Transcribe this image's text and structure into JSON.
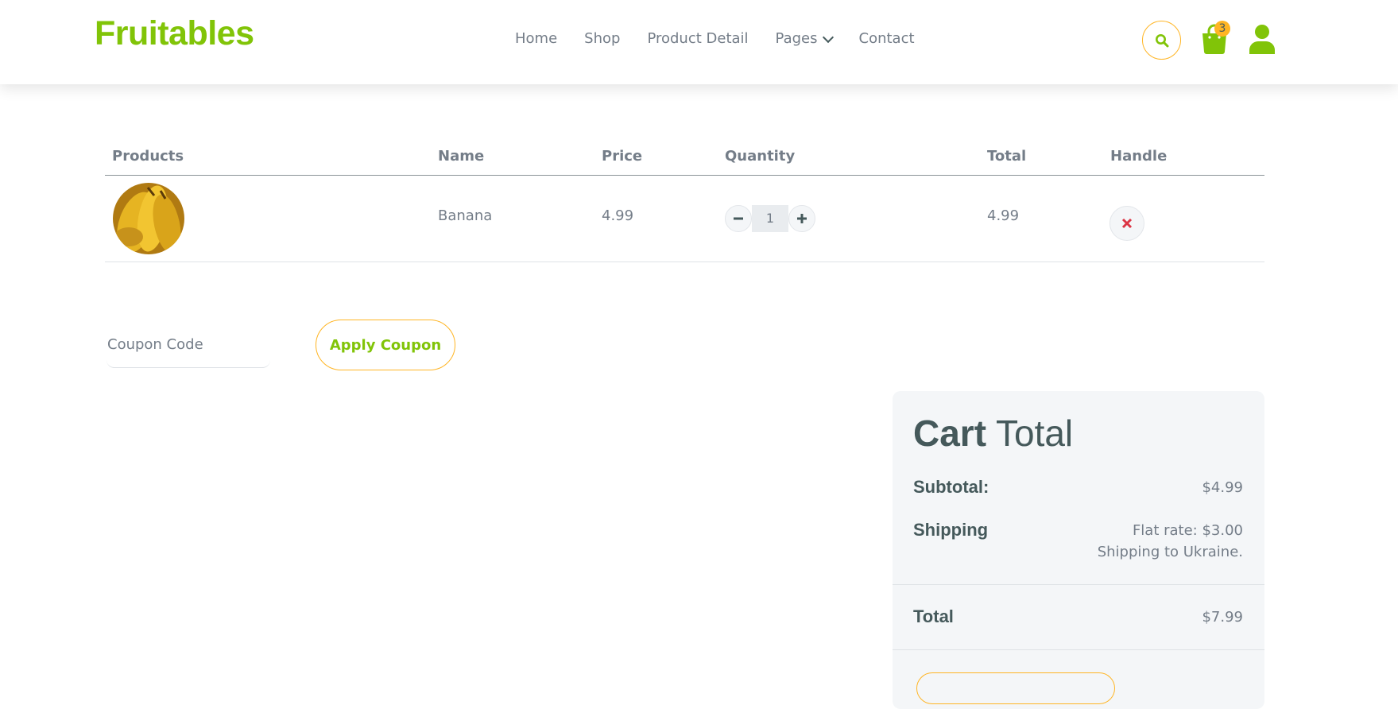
{
  "brand": {
    "name": "Fruitables",
    "color": "#81c408",
    "accent": "#ffb524"
  },
  "nav": {
    "items": [
      "Home",
      "Shop",
      "Product Detail",
      "Pages",
      "Contact"
    ],
    "pages_has_dropdown": true
  },
  "header_icons": {
    "search": "search-icon",
    "cart": "shopping-bag-icon",
    "cart_count": "3",
    "user": "user-icon"
  },
  "table": {
    "headers": [
      "Products",
      "Name",
      "Price",
      "Quantity",
      "Total",
      "Handle"
    ],
    "rows": [
      {
        "image": "banana-image",
        "name": "Banana",
        "price": "4.99",
        "quantity": "1",
        "total": "4.99"
      }
    ]
  },
  "coupon": {
    "placeholder": "Coupon Code",
    "button": "Apply Coupon"
  },
  "cart_total": {
    "title_bold": "Cart",
    "title_light": "Total",
    "subtotal_label": "Subtotal:",
    "subtotal_value": "$4.99",
    "shipping_label": "Shipping",
    "shipping_rate": "Flat rate: $3.00",
    "shipping_to": "Shipping to Ukraine.",
    "total_label": "Total",
    "total_value": "$7.99"
  }
}
